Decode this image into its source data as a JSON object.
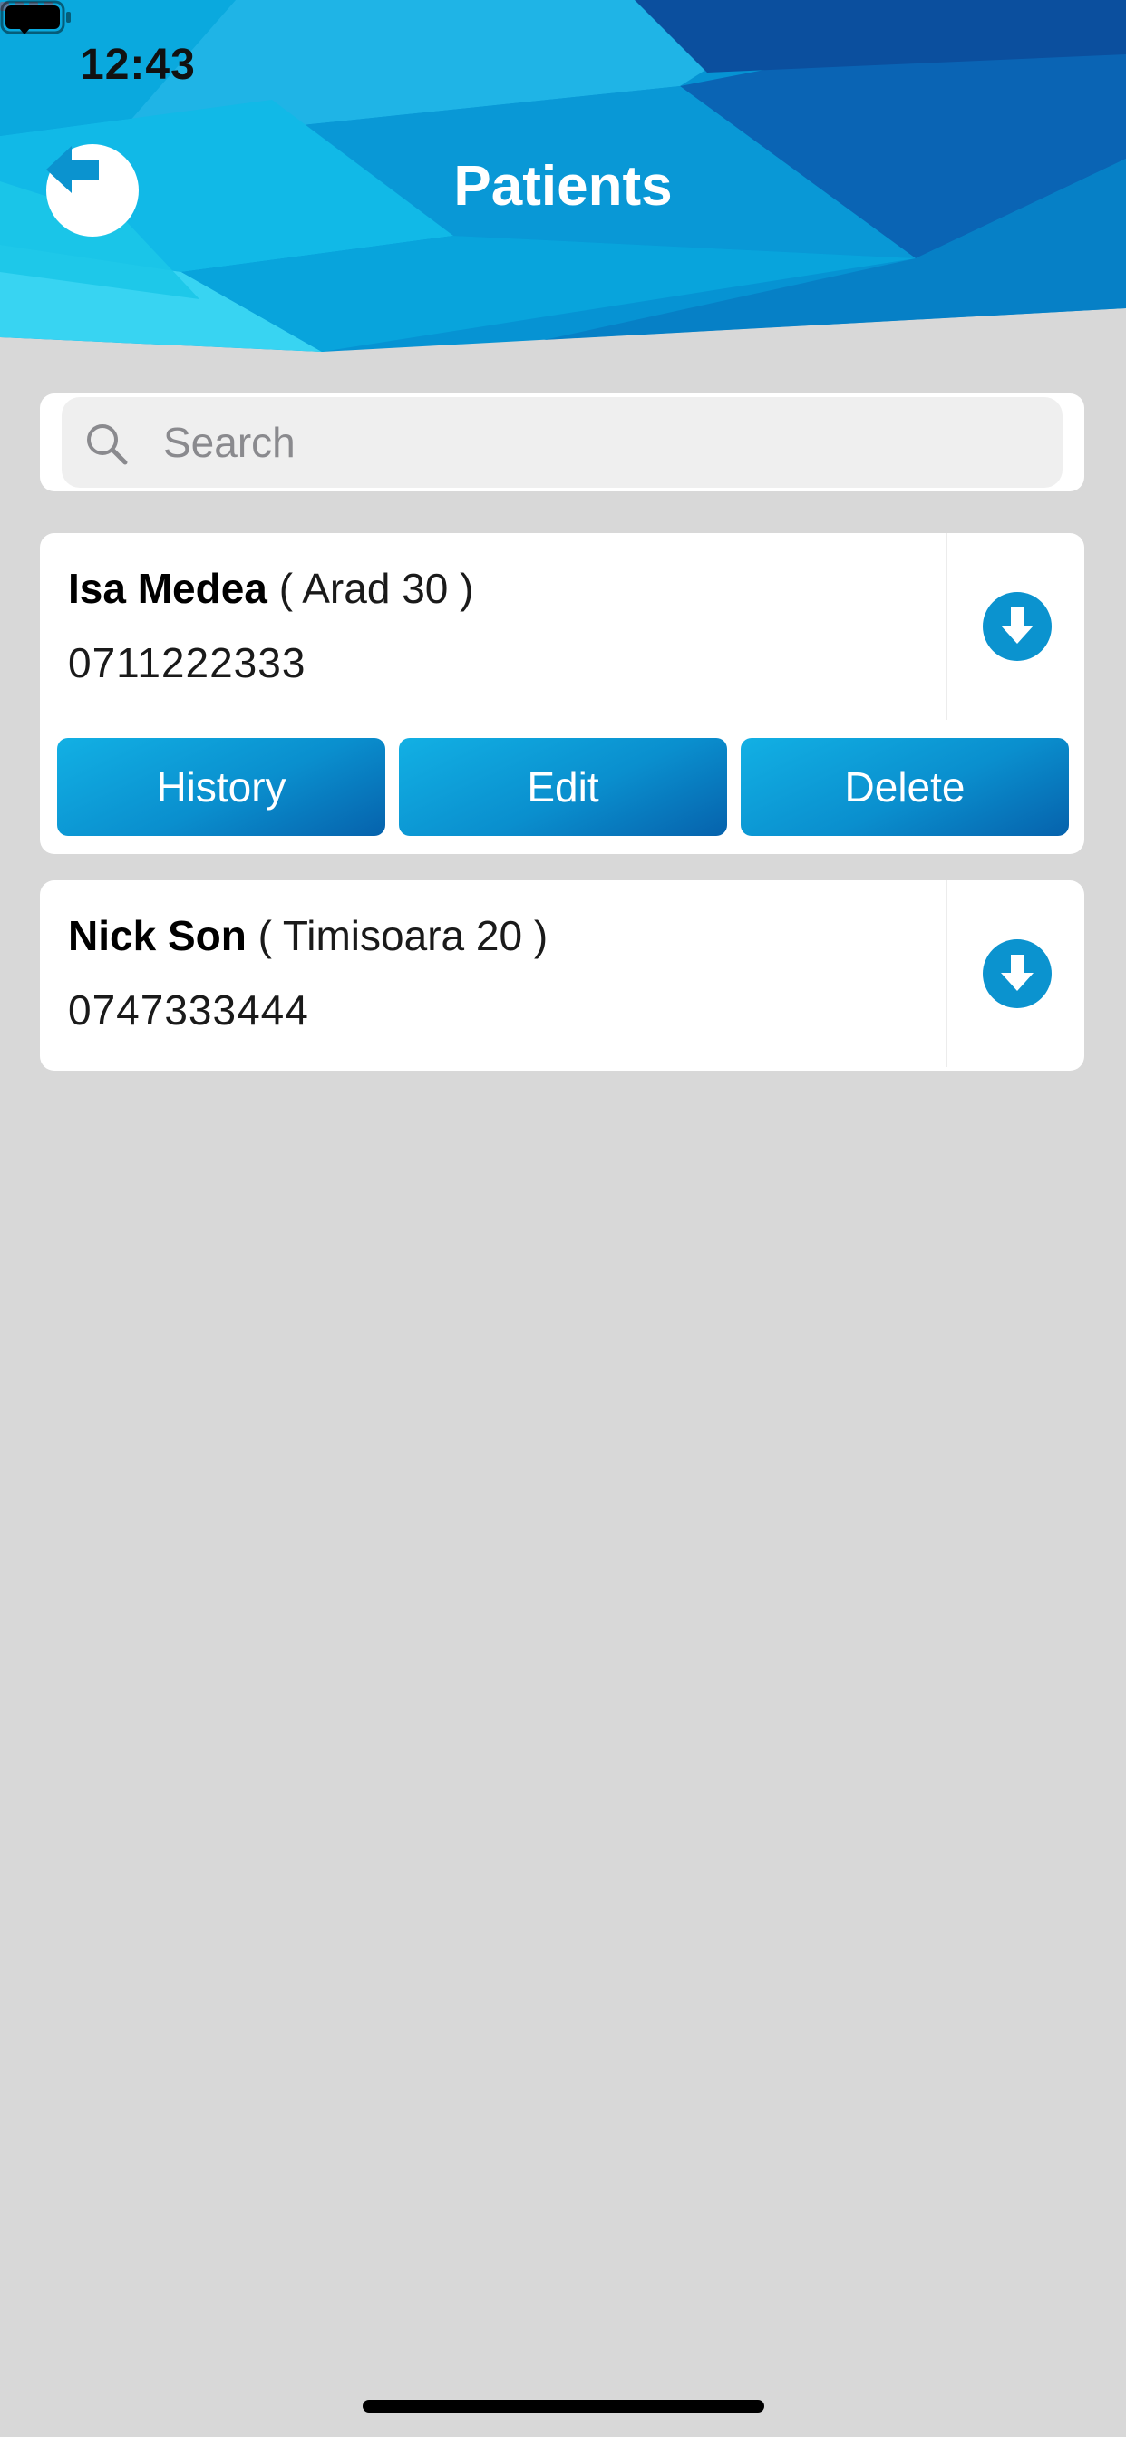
{
  "status_bar": {
    "time": "12:43"
  },
  "header": {
    "title": "Patients"
  },
  "search": {
    "placeholder": "Search",
    "value": ""
  },
  "patients": [
    {
      "name": "Isa Medea",
      "address": "( Arad 30 )",
      "phone": "0711222333",
      "expanded": true,
      "actions": {
        "history": "History",
        "edit": "Edit",
        "delete": "Delete"
      }
    },
    {
      "name": "Nick Son",
      "address": "( Timisoara 20 )",
      "phone": "0747333444",
      "expanded": false
    }
  ],
  "icons": {
    "back": "arrow-left-icon",
    "search": "magnifier-icon",
    "download": "arrow-down-circle-icon",
    "wifi": "wifi-icon",
    "battery": "battery-icon",
    "signal": "cellular-signal-icon"
  },
  "colors": {
    "accent": "#0b93cf",
    "header_dark": "#0a4f9c",
    "background": "#d8d8d8",
    "card": "#ffffff"
  }
}
